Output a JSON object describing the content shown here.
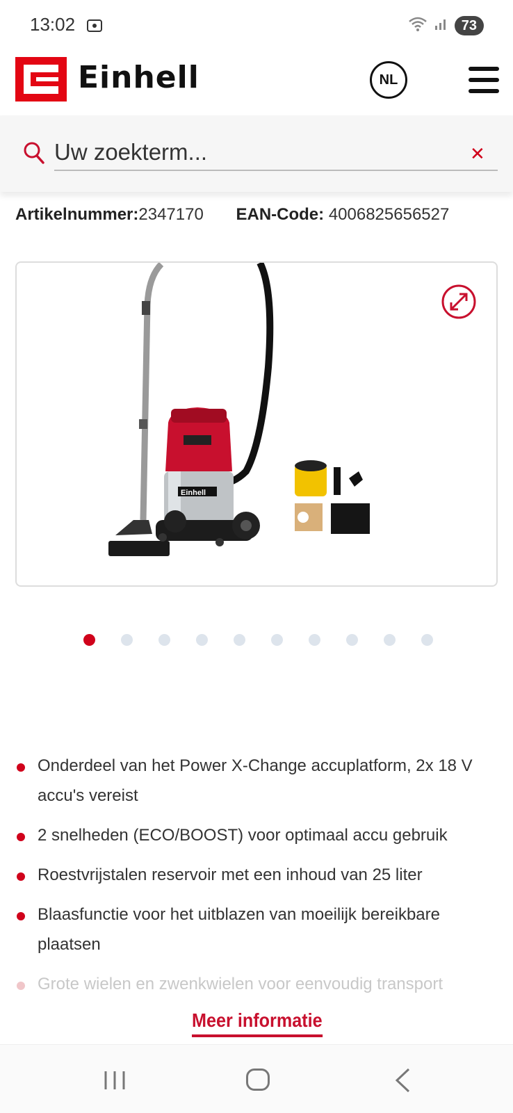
{
  "status_bar": {
    "time": "13:02",
    "battery": "73"
  },
  "header": {
    "brand": "Einhell",
    "language": "NL"
  },
  "search": {
    "placeholder": "Uw zoekterm..."
  },
  "article": {
    "number_label": "Artikelnummer:",
    "number_value": "2347170",
    "ean_label": "EAN-Code:",
    "ean_value": "4006825656527"
  },
  "gallery": {
    "total_slides": 10,
    "active_index": 0
  },
  "features": [
    "Onderdeel van het Power X-Change accuplatform, 2x 18 V accu's vereist",
    "2 snelheden (ECO/BOOST) voor optimaal accu gebruik",
    "Roestvrijstalen reservoir met een inhoud van 25 liter",
    "Blaasfunctie voor het uitblazen van moeilijk bereikbare plaatsen",
    "Grote wielen en zwenkwielen voor eenvoudig transport"
  ],
  "more_info_label": "Meer informatie",
  "colors": {
    "brand_red": "#e30613",
    "accent_red": "#c8102e",
    "dot_inactive": "#dde4ec"
  },
  "icons": [
    "photo-icon",
    "wifi-icon",
    "signal-icon",
    "search-icon",
    "close-icon",
    "expand-icon",
    "recent-apps-icon",
    "home-icon",
    "back-icon"
  ]
}
